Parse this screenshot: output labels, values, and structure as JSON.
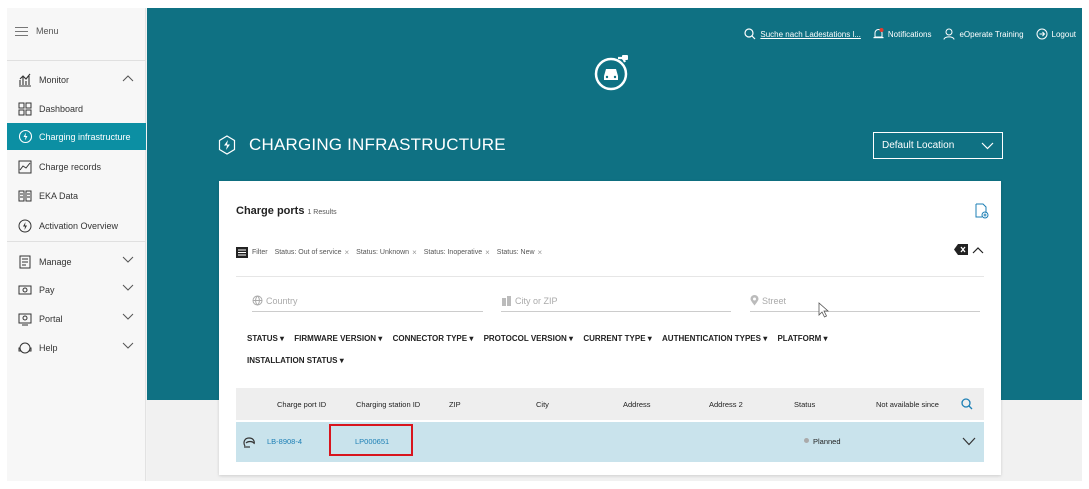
{
  "sidebar": {
    "menu_label": "Menu",
    "items": [
      {
        "label": "Monitor"
      },
      {
        "label": "Dashboard"
      },
      {
        "label": "Charging infrastructure"
      },
      {
        "label": "Charge records"
      },
      {
        "label": "EKA Data"
      },
      {
        "label": "Activation Overview"
      },
      {
        "label": "Manage"
      },
      {
        "label": "Pay"
      },
      {
        "label": "Portal"
      },
      {
        "label": "Help"
      }
    ],
    "active_color": "#0c8fa3"
  },
  "topnav": {
    "search_label": "Suche nach Ladestations l...",
    "notifications_label": "Notifications",
    "user_label": "eOperate Training",
    "logout_label": "Logout"
  },
  "header": {
    "title": "CHARGING INFRASTRUCTURE",
    "location_select": "Default Location",
    "brand_color": "#0f7183"
  },
  "card": {
    "title": "Charge ports",
    "results": "1 Results",
    "filter_label": "Filter",
    "chips": [
      {
        "label": "Status: Out of service"
      },
      {
        "label": "Status: Unknown"
      },
      {
        "label": "Status: Inoperative"
      },
      {
        "label": "Status: New"
      }
    ],
    "inputs": {
      "country_placeholder": "Country",
      "city_placeholder": "City or ZIP",
      "street_placeholder": "Street"
    },
    "dropdown_filters": [
      "STATUS ▾",
      "FIRMWARE VERSION ▾",
      "CONNECTOR TYPE ▾",
      "PROTOCOL VERSION ▾",
      "CURRENT TYPE ▾",
      "AUTHENTICATION TYPES ▾",
      "PLATFORM ▾",
      "INSTALLATION STATUS ▾"
    ]
  },
  "table": {
    "columns": [
      "Charge port ID",
      "Charging station ID",
      "ZIP",
      "City",
      "Address",
      "Address 2",
      "Status",
      "Not available since"
    ],
    "rows": [
      {
        "charge_port_id": "LB-8908-4",
        "charging_station_id": "LP000651",
        "status": "Planned"
      }
    ],
    "highlight_color": "#d8151e",
    "row_color": "#c9e3ec"
  }
}
